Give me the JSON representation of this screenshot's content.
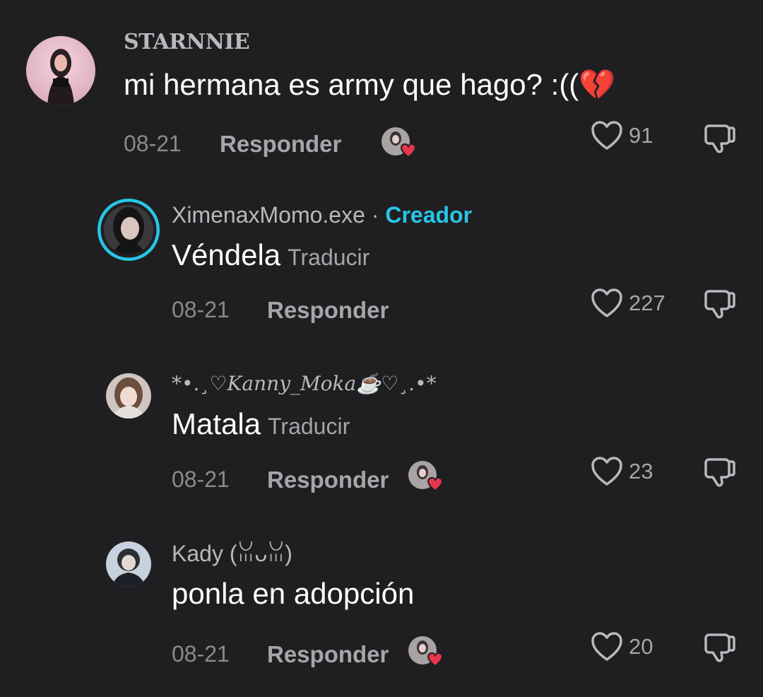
{
  "comments": [
    {
      "username": "STARNNIE",
      "text": "mi hermana es army que hago? :((💔",
      "date": "08-21",
      "reply_label": "Responder",
      "likes": "91",
      "creator_liked": true
    },
    {
      "username": "XimenaxMomo.exe",
      "separator": " · ",
      "creator_badge": "Creador",
      "text": "Véndela",
      "translate_label": "Traducir",
      "date": "08-21",
      "reply_label": "Responder",
      "likes": "227",
      "creator_liked": false
    },
    {
      "username": "*•.¸♡Kanny_Moka☕♡¸.•*",
      "text": "Matala",
      "translate_label": "Traducir",
      "date": "08-21",
      "reply_label": "Responder",
      "likes": "23",
      "creator_liked": true
    },
    {
      "username": "Kady (ꈍᴗꈍ)",
      "text": "ponla en adopción",
      "date": "08-21",
      "reply_label": "Responder",
      "likes": "20",
      "creator_liked": true
    }
  ],
  "icons": {
    "like": "heart-outline-icon",
    "dislike": "thumbs-down-icon"
  },
  "colors": {
    "background": "#1f1f21",
    "creator_accent": "#27c6e5",
    "liked_heart": "#e8364f"
  }
}
